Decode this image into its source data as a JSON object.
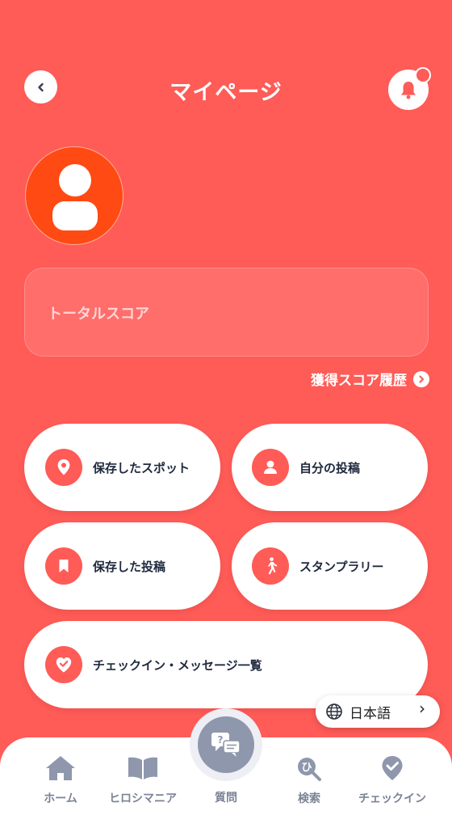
{
  "header": {
    "title": "マイページ"
  },
  "score": {
    "label": "トータルスコア",
    "history_link": "獲得スコア履歴"
  },
  "menu": {
    "saved_spots": "保存したスポット",
    "my_posts": "自分の投稿",
    "saved_posts": "保存した投稿",
    "stamp_rally": "スタンプラリー",
    "checkin_messages": "チェックイン・メッセージ一覧"
  },
  "language": {
    "label": "日本語"
  },
  "tabbar": {
    "home": "ホーム",
    "hiroshimania": "ヒロシマニア",
    "question": "質問",
    "search": "検索",
    "checkin": "チェックイン"
  },
  "colors": {
    "accent": "#FF5B57",
    "avatar": "#FF4A14",
    "text_dark": "#202A3F",
    "tab_icon": "#8E97AC"
  }
}
